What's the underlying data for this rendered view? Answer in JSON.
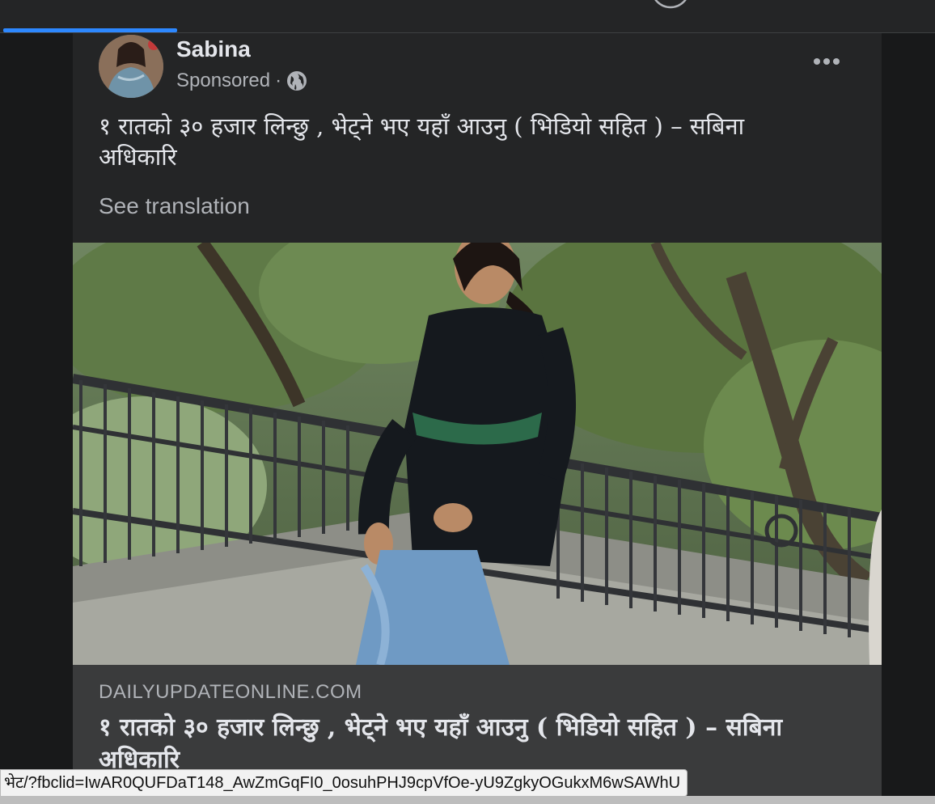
{
  "nav": {
    "items": [
      {
        "name": "home-icon"
      },
      {
        "name": "watch-icon"
      },
      {
        "name": "marketplace-icon"
      },
      {
        "name": "groups-icon"
      },
      {
        "name": "gaming-icon"
      }
    ],
    "active_color": "#2d88ff"
  },
  "post": {
    "author": "Sabina",
    "sponsored_label": "Sponsored",
    "separator": "·",
    "privacy_icon": "globe-icon",
    "more_icon": "more-horizontal-icon",
    "text": "१ रातको ३० हजार लिन्छु , भेट्ने भए यहाँ आउनु ( भिडियो सहित ) – सबिना अधिकारि",
    "see_translation": "See translation",
    "image": "photo-woman-leaning-on-railing"
  },
  "link_preview": {
    "domain": "DAILYUPDATEONLINE.COM",
    "title": "१ रातको ३० हजार लिन्छु , भेट्ने भए यहाँ आउनु ( भिडियो सहित ) – सबिना अधिकारि"
  },
  "status_bar": {
    "url": "भेट/?fbclid=IwAR0QUFDaT148_AwZmGqFI0_0osuhPHJ9cpVfOe-yU9ZgkyOGukxM6wSAWhU"
  },
  "colors": {
    "background": "#18191a",
    "card": "#242526",
    "preview": "#3a3b3c",
    "primary_text": "#e4e6eb",
    "secondary_text": "#b0b3b8"
  }
}
